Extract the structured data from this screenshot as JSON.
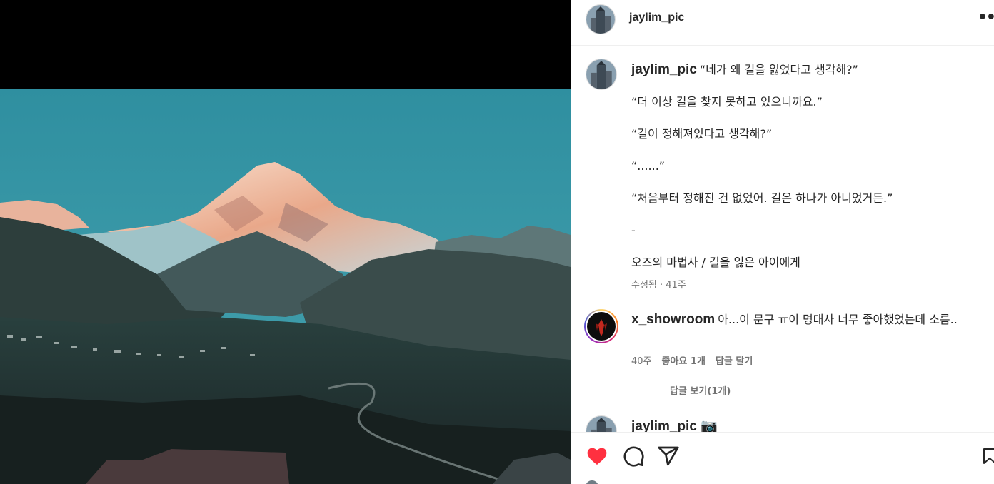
{
  "post": {
    "username": "jaylim_pic",
    "more_label": "••"
  },
  "caption": {
    "author": "jaylim_pic",
    "lines": [
      "“네가 왜 길을 잃었다고 생각해?”",
      "“더 이상 길을 찾지 못하고 있으니까요.”",
      "“길이 정해져있다고 생각해?”",
      "“......”",
      "“처음부터 정해진 건 없었어. 길은 하나가 아니었거든.”",
      "-",
      "오즈의 마법사 / 길을 잃은 아이에게"
    ],
    "meta": "수정됨 · 41주"
  },
  "comments": [
    {
      "author": "x_showroom",
      "text": "아...이 문구 ㅠ이 명대사 너무 좋아했었는데 소름..",
      "age": "40주",
      "likes": "좋아요 1개",
      "reply_label": "답글 달기",
      "view_replies": "답글 보기(1개)"
    },
    {
      "author": "jaylim_pic 📷"
    }
  ],
  "icons": {
    "like": "heart-icon",
    "comment": "comment-icon",
    "share": "share-icon",
    "save": "bookmark-icon",
    "like_color": "#ff3040"
  }
}
